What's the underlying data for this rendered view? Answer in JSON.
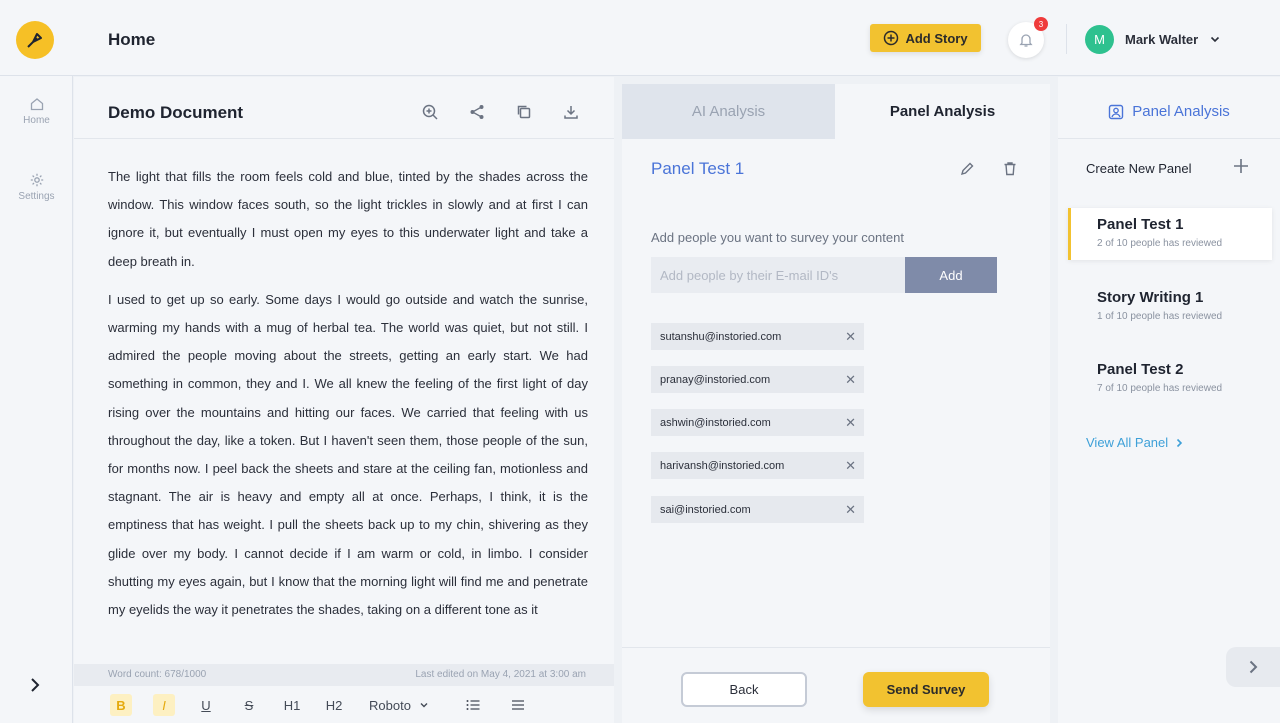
{
  "header": {
    "title": "Home",
    "add_story_label": "Add Story",
    "notification_count": "3",
    "user_initial": "M",
    "user_name": "Mark Walter"
  },
  "nav": {
    "home_label": "Home",
    "settings_label": "Settings"
  },
  "document": {
    "title": "Demo Document",
    "paragraphs": [
      "The light that fills the room feels cold and blue, tinted by the shades across the window. This window faces south, so the light trickles in slowly and at first I can ignore it, but eventually I must open my eyes to this underwater light and take a deep breath in.",
      "I used to get up so early. Some days I would go outside and watch the sunrise, warming my hands with a mug of herbal tea. The world was quiet, but not still. I admired the people moving about the streets, getting an early start. We had something in common, they and I. We all knew the feeling of the first light of day rising over the mountains and hitting our faces. We carried that feeling with us throughout the day, like a token. But I haven't seen them, those people of the sun, for months now. I peel back the sheets and stare at the ceiling fan, motionless and stagnant. The air is heavy and empty all at once. Perhaps, I think, it is the emptiness that has weight. I pull the sheets back up to my chin, shivering as they glide over my body. I cannot decide if I am warm or cold, in limbo. I consider shutting my eyes again, but I know that the morning light will find me and penetrate my eyelids the way it penetrates the shades, taking on a different tone as it"
    ],
    "word_count": "Word count: 678/1000",
    "last_edited": "Last edited on May 4, 2021 at 3:00 am",
    "format": {
      "bold": "B",
      "italic": "I",
      "underline": "U",
      "strike": "S",
      "h1": "H1",
      "h2": "H2",
      "font": "Roboto"
    }
  },
  "analysis": {
    "tabs": [
      {
        "label": "AI Analysis"
      },
      {
        "label": "Panel Analysis"
      }
    ],
    "panel_title": "Panel Test 1",
    "add_people_label": "Add people you want to survey your content",
    "email_placeholder": "Add people by their E-mail ID's",
    "add_label": "Add",
    "emails": [
      "sutanshu@instoried.com",
      "pranay@instoried.com",
      "ashwin@instoried.com",
      "harivansh@instoried.com",
      "sai@instoried.com"
    ],
    "back_label": "Back",
    "send_label": "Send Survey"
  },
  "sidebar": {
    "title": "Panel Analysis",
    "create_label": "Create New Panel",
    "panels": [
      {
        "name": "Panel Test 1",
        "subtitle": "2 of 10 people has reviewed"
      },
      {
        "name": "Story Writing 1",
        "subtitle": "1 of 10 people has reviewed"
      },
      {
        "name": "Panel Test 2",
        "subtitle": "7 of 10 people has reviewed"
      }
    ],
    "view_all_label": "View All Panel"
  },
  "colors": {
    "accent_yellow": "#f2c230",
    "link_blue": "#4a74d8",
    "avatar_green": "#2ec18f",
    "badge_red": "#ef3b3b"
  }
}
